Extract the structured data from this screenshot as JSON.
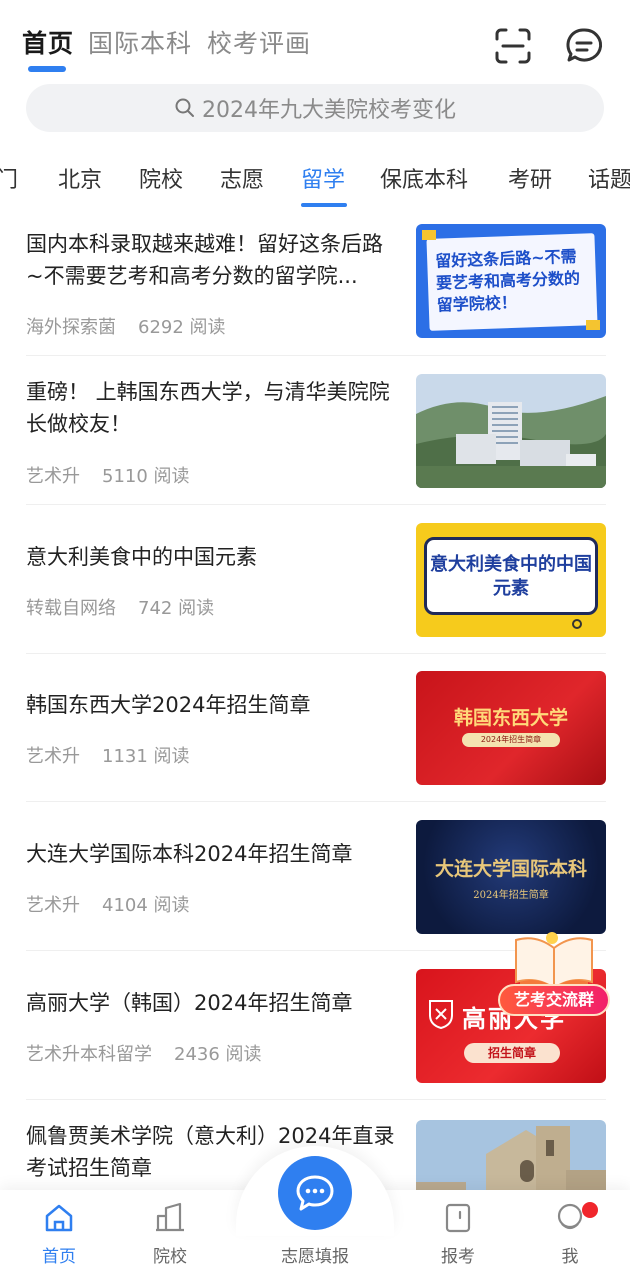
{
  "top_tabs": [
    {
      "label": "首页",
      "active": true
    },
    {
      "label": "国际本科",
      "active": false
    },
    {
      "label": "校考评画",
      "active": false
    }
  ],
  "top_icons": [
    "scan-icon",
    "message-icon"
  ],
  "search": {
    "placeholder": "2024年九大美院校考变化"
  },
  "categories": [
    {
      "label": "门"
    },
    {
      "label": "北京"
    },
    {
      "label": "院校"
    },
    {
      "label": "志愿"
    },
    {
      "label": "留学",
      "active": true
    },
    {
      "label": "保底本科"
    },
    {
      "label": "考研"
    },
    {
      "label": "话题"
    }
  ],
  "articles": [
    {
      "title": "国内本科录取越来越难！留好这条后路~不需要艺考和高考分数的留学院...",
      "author": "海外探索菌",
      "views": "6292 阅读",
      "thumb_text": "留好这条后路~不需要艺考和高考分数的留学院校！"
    },
    {
      "title": "重磅！ 上韩国东西大学，与清华美院院长做校友！",
      "author": "艺术升",
      "views": "5110 阅读",
      "thumb_text": ""
    },
    {
      "title": "意大利美食中的中国元素",
      "author": "转载自网络",
      "views": "742 阅读",
      "thumb_text": "意大利美食中的中国元素"
    },
    {
      "title": "韩国东西大学2024年招生简章",
      "author": "艺术升",
      "views": "1131 阅读",
      "thumb_text": "韩国东西大学",
      "thumb_sub": "2024年招生简章"
    },
    {
      "title": "大连大学国际本科2024年招生简章",
      "author": "艺术升",
      "views": "4104 阅读",
      "thumb_text": "大连大学国际本科",
      "thumb_sub": "2024年招生简章"
    },
    {
      "title": "高丽大学（韩国）2024年招生简章",
      "author": "艺术升本科留学",
      "views": "2436 阅读",
      "thumb_text": "高丽大学",
      "thumb_sub": "招生简章"
    },
    {
      "title": "佩鲁贾美术学院（意大利）2024年直录考试招生简章",
      "author": "",
      "views": "",
      "thumb_text": ""
    }
  ],
  "float_badge": {
    "label": "艺考交流群"
  },
  "bottom_nav": [
    {
      "label": "首页",
      "icon": "home-icon",
      "active": true
    },
    {
      "label": "院校",
      "icon": "school-icon"
    },
    {
      "label": "志愿填报",
      "icon": "chat-bubble-icon"
    },
    {
      "label": "报考",
      "icon": "apply-icon"
    },
    {
      "label": "我",
      "icon": "profile-icon",
      "badge": true
    }
  ],
  "colors": {
    "accent": "#2f7ff0",
    "badge_red": "#f0262c"
  }
}
